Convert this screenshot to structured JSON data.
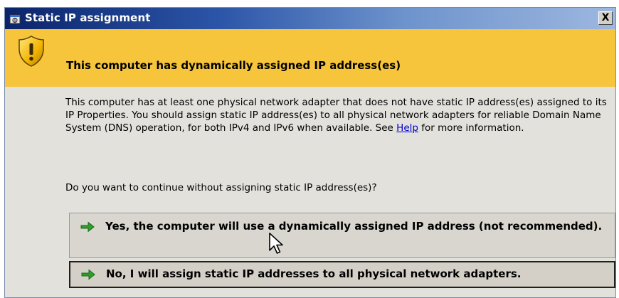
{
  "window": {
    "title": "Static IP assignment",
    "close_label": "X"
  },
  "banner": {
    "message": "This computer has dynamically assigned IP address(es)"
  },
  "body": {
    "paragraph_before_link": "This computer has at least one physical network adapter that does not have static IP address(es) assigned to its IP Properties. You should assign static IP address(es) to all physical network adapters for reliable Domain Name System (DNS) operation, for both IPv4 and IPv6 when available. See ",
    "help_link": "Help",
    "paragraph_after_link": " for more information.",
    "question": "Do you want to continue without assigning static IP address(es)?"
  },
  "commands": {
    "yes_label": "Yes, the computer will use a dynamically assigned IP address (not recommended).",
    "no_label": "No, I will assign static IP addresses to all physical network adapters."
  },
  "icons": {
    "window": "network-window-icon",
    "warning": "warning-shield-icon",
    "command_arrow": "green-arrow-icon",
    "cursor": "mouse-pointer-icon"
  },
  "colors": {
    "banner": "#f6c53c",
    "arrow": "#2e9e2e",
    "link": "#0000cc"
  }
}
